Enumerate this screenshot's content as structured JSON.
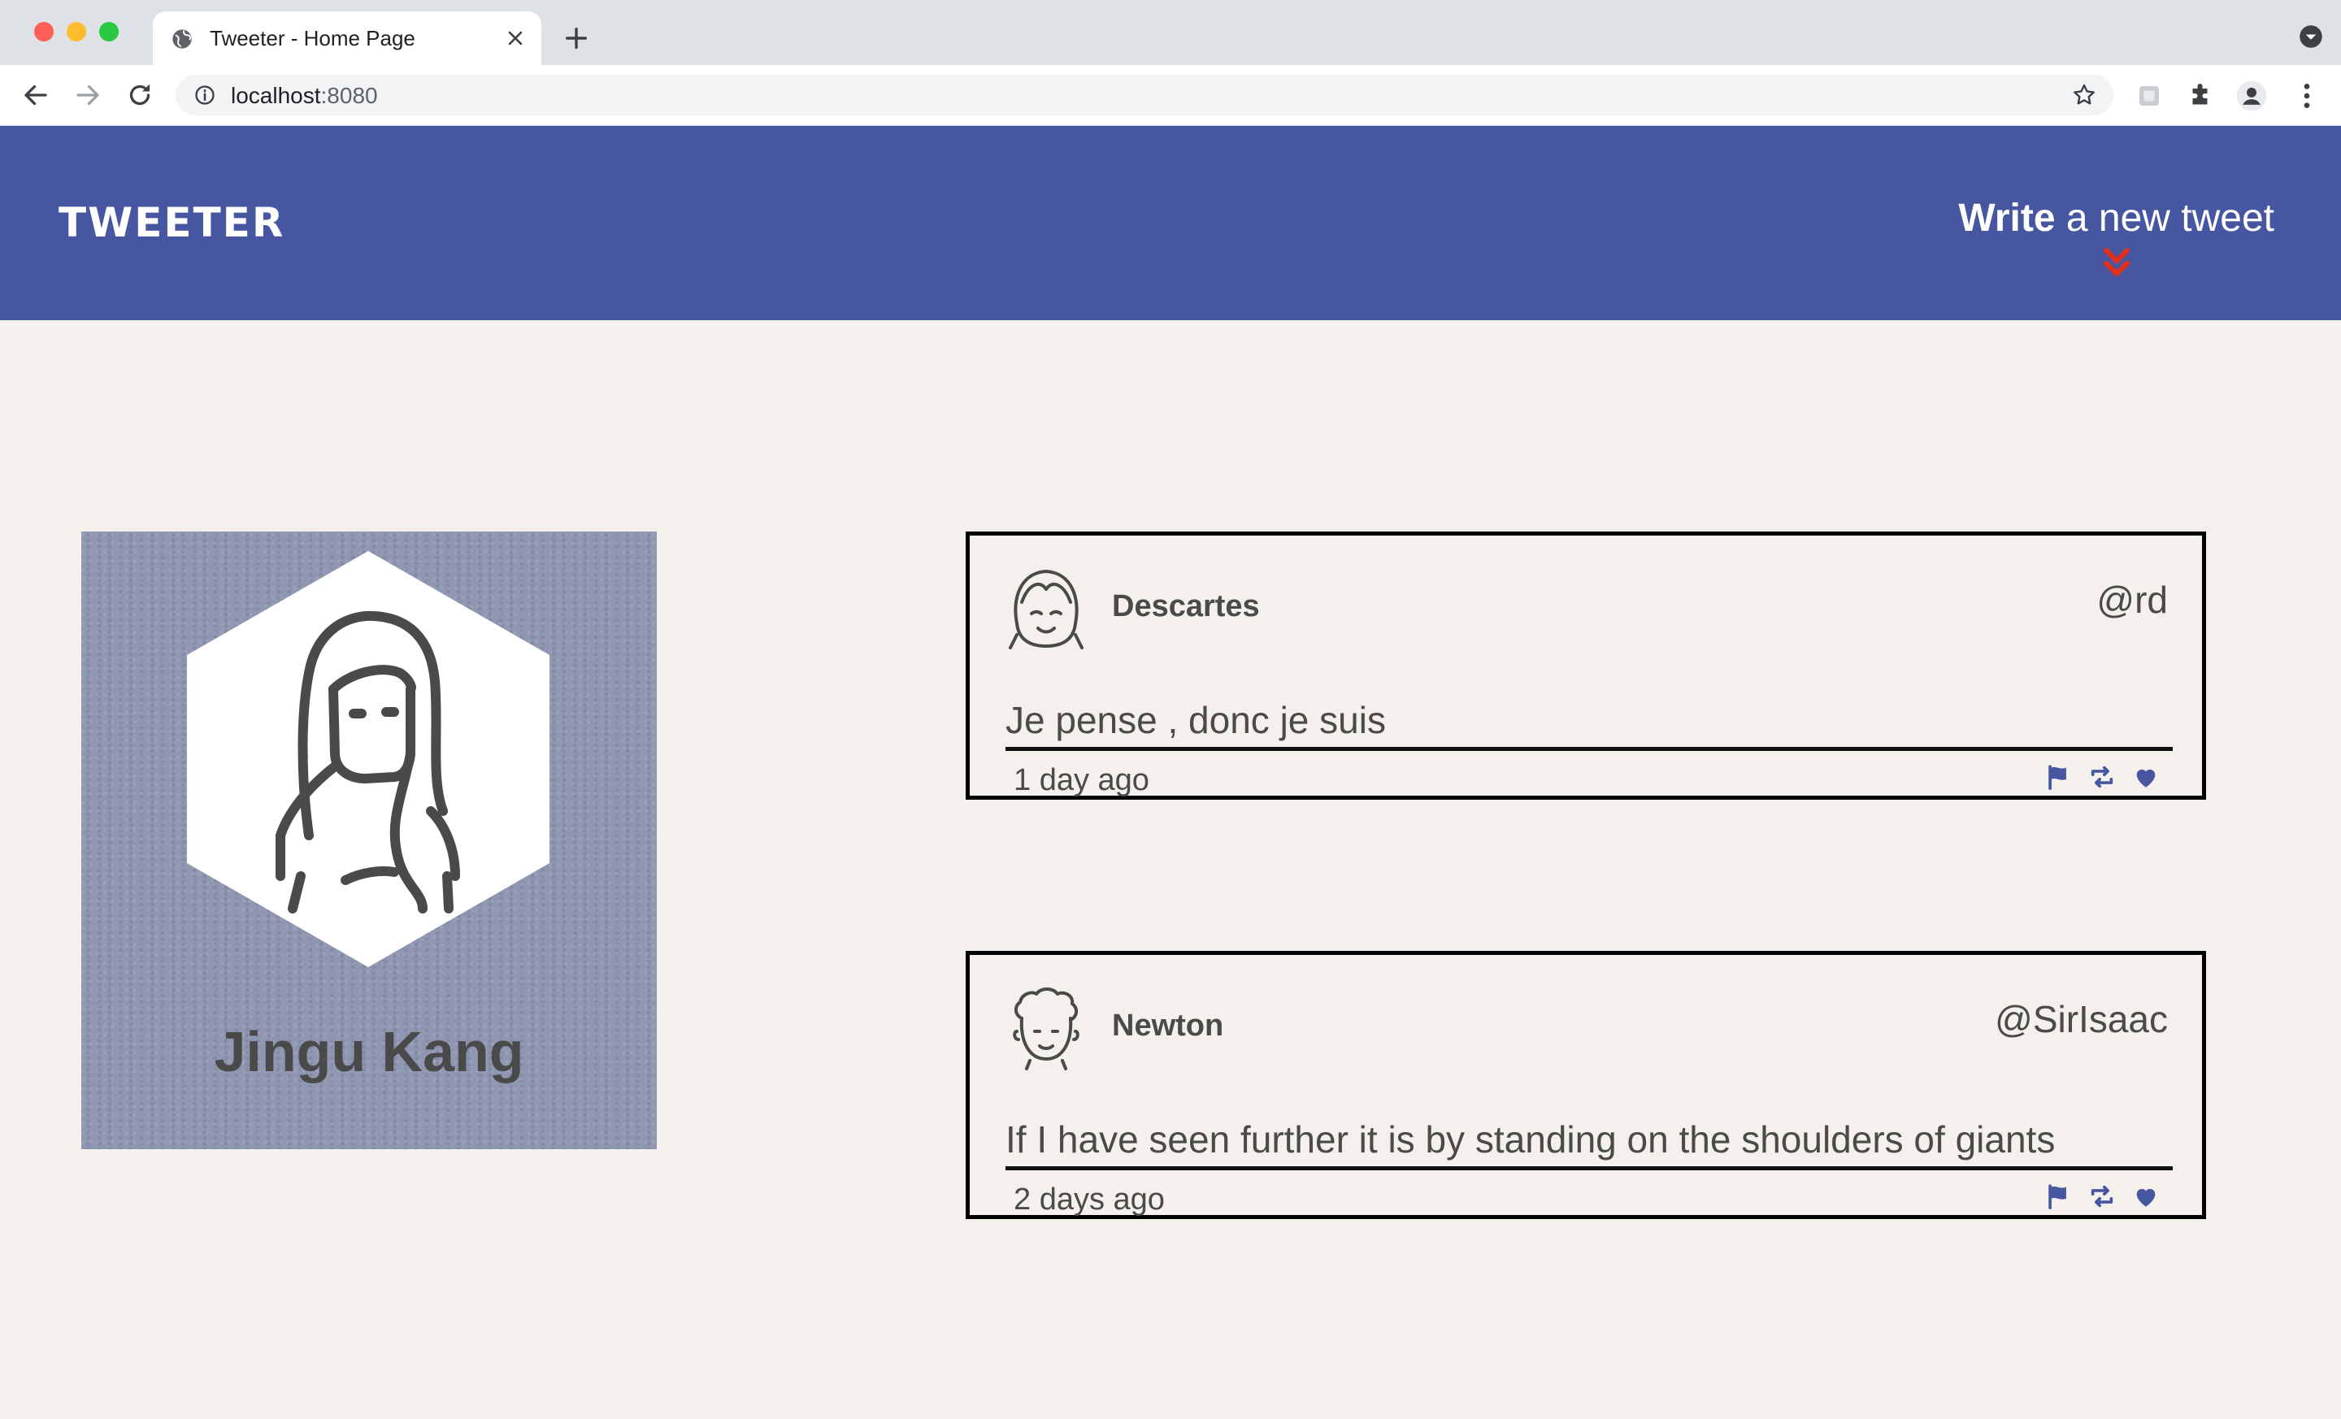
{
  "browser": {
    "tab_title": "Tweeter - Home Page",
    "url_host": "localhost",
    "url_port": ":8080"
  },
  "header": {
    "brand": "TWEETER",
    "compose_strong": "Write",
    "compose_rest": " a new tweet",
    "bg_color": "#4656a0",
    "arrow_color": "#e0301e"
  },
  "profile": {
    "name": "Jingu Kang"
  },
  "tweets": [
    {
      "author": "Descartes",
      "handle": "@rd",
      "text": "Je pense , donc je suis",
      "time": "1 day ago"
    },
    {
      "author": "Newton",
      "handle": "@SirIsaac",
      "text": "If I have seen further it is by standing on the shoulders of giants",
      "time": "2 days ago"
    }
  ],
  "icons": {
    "tweet_actions": [
      "flag-icon",
      "retweet-icon",
      "heart-icon"
    ],
    "action_color": "#4656a0"
  }
}
